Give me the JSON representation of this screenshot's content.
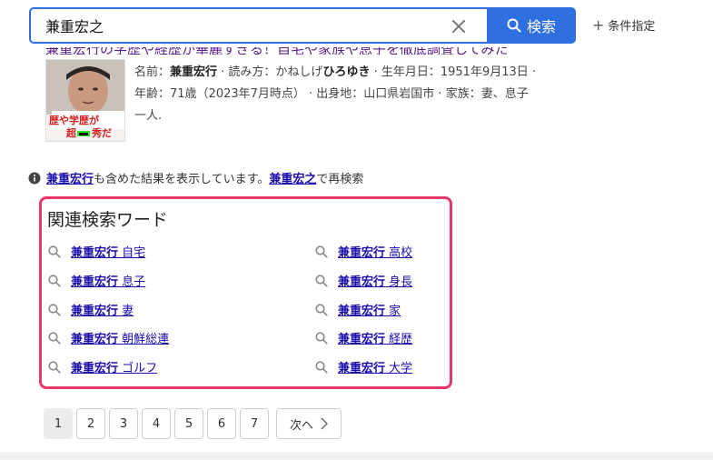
{
  "search": {
    "query": "兼重宏之",
    "button_label": "検索",
    "conditions_label": "条件指定"
  },
  "result": {
    "thumbnail_text_line1": "歴や学歴が",
    "thumbnail_text_line2": "超",
    "thumbnail_text_line3": "秀だ",
    "snippet": {
      "name_label": "名前：",
      "name": "兼重宏行",
      "reading_label": "· 読み方：かねしげ",
      "reading_bold": "ひろゆき",
      "birth": "· 生年月日：1951年9月13日 ·",
      "age": "年齢：71歳（2023年7月時点） · 出身地：山口県岩国市 · 家族：妻、息子",
      "tail": "一人."
    }
  },
  "notice": {
    "term": "兼重宏行",
    "middle": " も含めた結果を表示しています。",
    "original": "兼重宏之",
    "suffix": " で再検索"
  },
  "related": {
    "title": "関連検索ワード",
    "left": [
      {
        "bold": "兼重宏行",
        "rest": " 自宅"
      },
      {
        "bold": "兼重宏行",
        "rest": " 息子"
      },
      {
        "bold": "兼重宏行",
        "rest": " 妻"
      },
      {
        "bold": "兼重宏行",
        "rest": " 朝鮮総連"
      },
      {
        "bold": "兼重宏行",
        "rest": " ゴルフ"
      }
    ],
    "right": [
      {
        "bold": "兼重宏行",
        "rest": " 高校"
      },
      {
        "bold": "兼重宏行",
        "rest": " 身長"
      },
      {
        "bold": "兼重宏行",
        "rest": " 家"
      },
      {
        "bold": "兼重宏行",
        "rest": " 経歴"
      },
      {
        "bold": "兼重宏行",
        "rest": " 大学"
      }
    ]
  },
  "pagination": {
    "pages": [
      "1",
      "2",
      "3",
      "4",
      "5",
      "6",
      "7"
    ],
    "current": "1",
    "next_label": "次へ"
  },
  "colors": {
    "accent": "#2f6fe0",
    "highlight_border": "#e8386a",
    "link": "#1a0dab"
  }
}
